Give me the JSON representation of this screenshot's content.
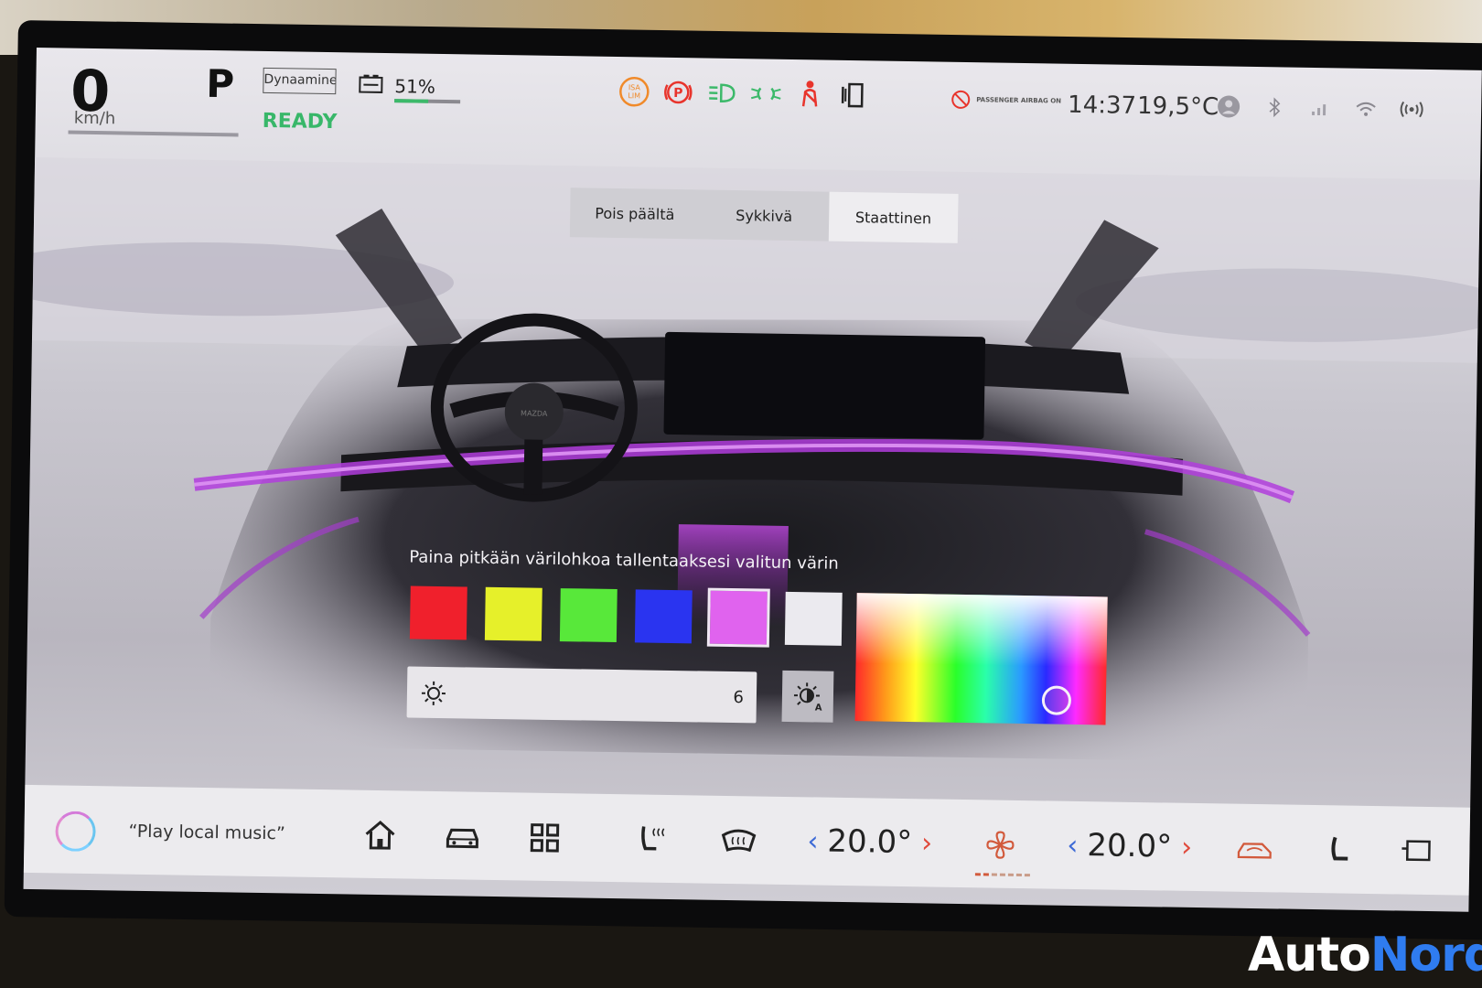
{
  "status": {
    "speed": "0",
    "speed_unit": "km/h",
    "gear": "P",
    "drive_mode": "Dynaaminen",
    "ready": "READY",
    "battery_percent_label": "51%",
    "battery_level": 0.51,
    "airbag_label": "PASSENGER AIRBAG ON",
    "time": "14:37",
    "outside_temp": "19,5°C"
  },
  "warning_icons": [
    "isa-lim-icon",
    "parking-brake-icon",
    "headlight-icon",
    "parking-lights-icon",
    "seatbelt-icon",
    "door-open-icon"
  ],
  "tabs": [
    {
      "label": "Pois päältä",
      "active": false
    },
    {
      "label": "Sykkivä",
      "active": false
    },
    {
      "label": "Staattinen",
      "active": true
    }
  ],
  "lighting": {
    "hint": "Paina pitkään värilohkoa tallentaaksesi valitun värin",
    "swatches": [
      {
        "name": "red",
        "color": "#f0202c"
      },
      {
        "name": "yellow",
        "color": "#e6f02a"
      },
      {
        "name": "green",
        "color": "#58e83a"
      },
      {
        "name": "blue",
        "color": "#2a34f0"
      },
      {
        "name": "magenta",
        "color": "#e063ee",
        "selected": true
      },
      {
        "name": "white",
        "color": "#ebeaef"
      }
    ],
    "brightness_value": "6",
    "accent_color": "#b23ddd"
  },
  "dock": {
    "voice_hint": "“Play local music”",
    "driver_temp": "20.0°",
    "passenger_temp": "20.0°",
    "fan_level": 2,
    "fan_steps": 7
  },
  "watermark": {
    "part1": "Auto",
    "part2": "Nord"
  }
}
